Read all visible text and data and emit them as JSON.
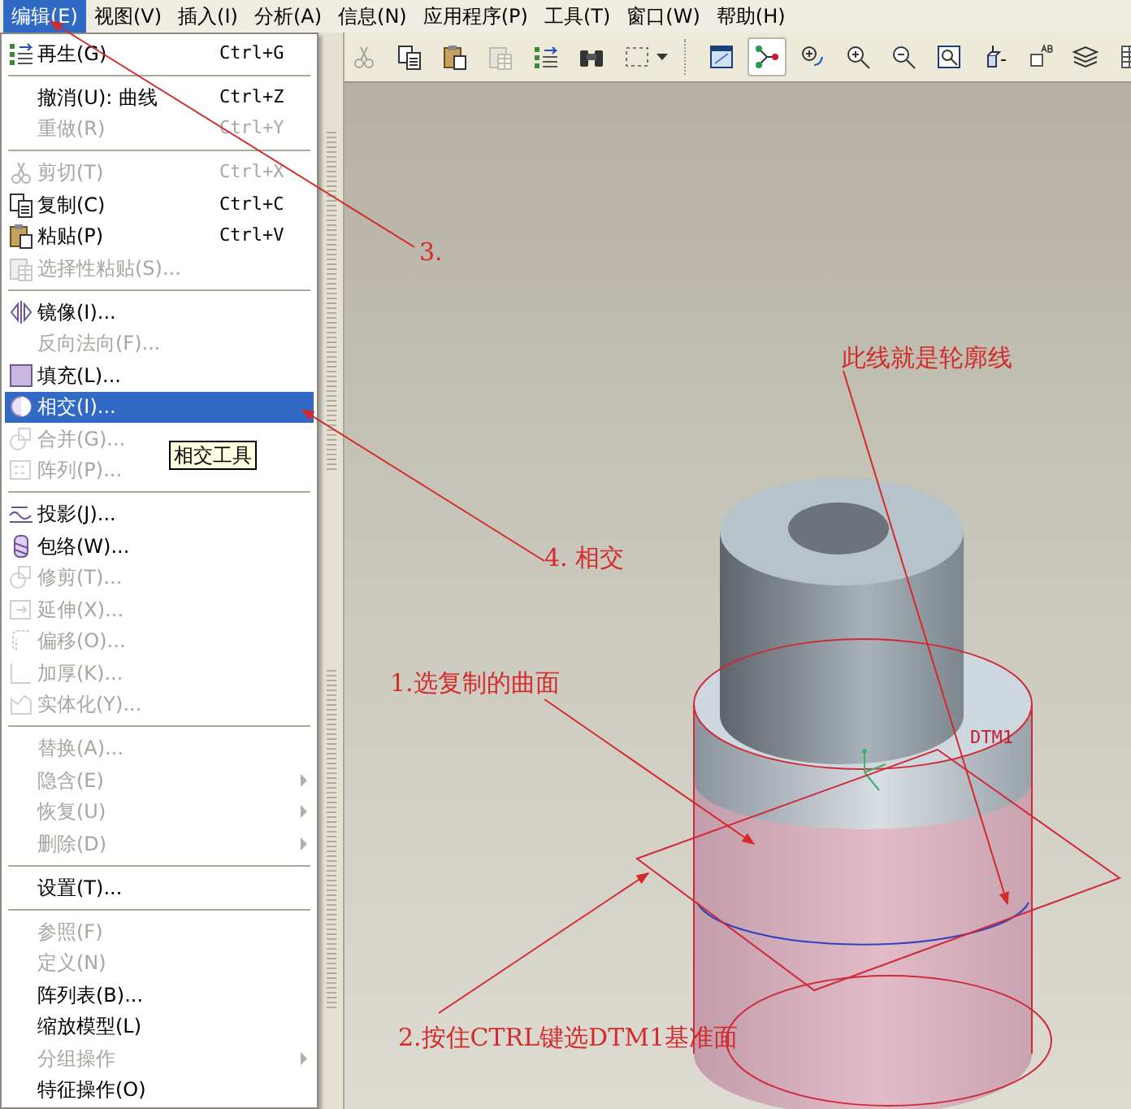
{
  "menu_bar": [
    {
      "label": "编辑(E)",
      "selected": true
    },
    {
      "label": "视图(V)",
      "selected": false
    },
    {
      "label": "插入(I)",
      "selected": false
    },
    {
      "label": "分析(A)",
      "selected": false
    },
    {
      "label": "信息(N)",
      "selected": false
    },
    {
      "label": "应用程序(P)",
      "selected": false
    },
    {
      "label": "工具(T)",
      "selected": false
    },
    {
      "label": "窗口(W)",
      "selected": false
    },
    {
      "label": "帮助(H)",
      "selected": false
    }
  ],
  "toolbar": [
    {
      "kind": "cut",
      "disabled": true,
      "pressed": false
    },
    {
      "kind": "copy",
      "disabled": false,
      "pressed": false
    },
    {
      "kind": "paste",
      "disabled": false,
      "pressed": false
    },
    {
      "kind": "paste-special",
      "disabled": true,
      "pressed": false
    },
    {
      "kind": "regenerate",
      "disabled": false,
      "pressed": false
    },
    {
      "kind": "find",
      "disabled": false,
      "pressed": false
    },
    {
      "kind": "select-box",
      "disabled": false,
      "pressed": false
    },
    {
      "kind": "separator"
    },
    {
      "kind": "sketch-view",
      "disabled": false,
      "pressed": false
    },
    {
      "kind": "datum-display",
      "disabled": false,
      "pressed": true
    },
    {
      "kind": "spin",
      "disabled": false,
      "pressed": false
    },
    {
      "kind": "zoom-in",
      "disabled": false,
      "pressed": false
    },
    {
      "kind": "zoom-out",
      "disabled": false,
      "pressed": false
    },
    {
      "kind": "refit",
      "disabled": false,
      "pressed": false
    },
    {
      "kind": "orient",
      "disabled": false,
      "pressed": false
    },
    {
      "kind": "named-view",
      "disabled": false,
      "pressed": false
    },
    {
      "kind": "layers",
      "disabled": false,
      "pressed": false
    },
    {
      "kind": "table",
      "disabled": false,
      "pressed": false
    }
  ],
  "edit_menu": {
    "items": [
      {
        "kind": "regenerate",
        "label": "再生(G)",
        "shortcut": "Ctrl+G",
        "disabled": false,
        "selected": false
      },
      {
        "kind": "separator"
      },
      {
        "kind": "plain",
        "label": "撤消(U):",
        "detail": "曲线",
        "shortcut": "Ctrl+Z",
        "disabled": false,
        "selected": false
      },
      {
        "kind": "plain",
        "label": "重做(R)",
        "shortcut": "Ctrl+Y",
        "disabled": true,
        "selected": false
      },
      {
        "kind": "separator"
      },
      {
        "kind": "cut",
        "label": "剪切(T)",
        "shortcut": "Ctrl+X",
        "disabled": true,
        "selected": false
      },
      {
        "kind": "copy",
        "label": "复制(C)",
        "shortcut": "Ctrl+C",
        "disabled": false,
        "selected": false
      },
      {
        "kind": "paste",
        "label": "粘贴(P)",
        "shortcut": "Ctrl+V",
        "disabled": false,
        "selected": false
      },
      {
        "kind": "paste-special",
        "label": "选择性粘贴(S)...",
        "disabled": true,
        "selected": false
      },
      {
        "kind": "separator"
      },
      {
        "kind": "mirror",
        "label": "镜像(I)...",
        "disabled": false,
        "selected": false
      },
      {
        "kind": "plain",
        "label": "反向法向(F)...",
        "disabled": true,
        "selected": false
      },
      {
        "kind": "fill",
        "label": "填充(L)...",
        "disabled": false,
        "selected": false
      },
      {
        "kind": "intersect",
        "label": "相交(I)...",
        "disabled": false,
        "selected": true
      },
      {
        "kind": "merge",
        "label": "合并(G)...",
        "disabled": true,
        "selected": false
      },
      {
        "kind": "pattern",
        "label": "阵列(P)...",
        "disabled": true,
        "selected": false
      },
      {
        "kind": "separator"
      },
      {
        "kind": "project",
        "label": "投影(J)...",
        "disabled": false,
        "selected": false
      },
      {
        "kind": "wrap",
        "label": "包络(W)...",
        "disabled": false,
        "selected": false
      },
      {
        "kind": "merge",
        "label": "修剪(T)...",
        "disabled": true,
        "selected": false
      },
      {
        "kind": "extend",
        "label": "延伸(X)...",
        "disabled": true,
        "selected": false
      },
      {
        "kind": "offset",
        "label": "偏移(O)...",
        "disabled": true,
        "selected": false
      },
      {
        "kind": "thicken",
        "label": "加厚(K)...",
        "disabled": true,
        "selected": false
      },
      {
        "kind": "solidify",
        "label": "实体化(Y)...",
        "disabled": true,
        "selected": false
      },
      {
        "kind": "separator"
      },
      {
        "kind": "plain",
        "label": "替换(A)...",
        "disabled": true,
        "selected": false
      },
      {
        "kind": "plain",
        "label": "隐含(E)",
        "disabled": true,
        "selected": false,
        "submenu": true
      },
      {
        "kind": "plain",
        "label": "恢复(U)",
        "disabled": true,
        "selected": false,
        "submenu": true
      },
      {
        "kind": "plain",
        "label": "删除(D)",
        "disabled": true,
        "selected": false,
        "submenu": true
      },
      {
        "kind": "separator"
      },
      {
        "kind": "plain",
        "label": "设置(T)...",
        "disabled": false,
        "selected": false
      },
      {
        "kind": "separator"
      },
      {
        "kind": "plain",
        "label": "参照(F)",
        "disabled": true,
        "selected": false
      },
      {
        "kind": "plain",
        "label": "定义(N)",
        "disabled": true,
        "selected": false
      },
      {
        "kind": "plain",
        "label": "阵列表(B)...",
        "disabled": false,
        "selected": false
      },
      {
        "kind": "plain",
        "label": "缩放模型(L)",
        "disabled": false,
        "selected": false
      },
      {
        "kind": "plain",
        "label": "分组操作",
        "disabled": true,
        "selected": false,
        "submenu": true
      },
      {
        "kind": "plain",
        "label": "特征操作(O)",
        "disabled": false,
        "selected": false
      }
    ]
  },
  "tooltip": "相交工具",
  "model": {
    "datum_label": "DTM1"
  },
  "annotations": [
    {
      "text": "3."
    },
    {
      "text": "4. 相交"
    },
    {
      "text": "此线就是轮廓线"
    },
    {
      "text": "1.选复制的曲面"
    },
    {
      "text": "2.按住CTRL键选DTM1基准面"
    }
  ]
}
